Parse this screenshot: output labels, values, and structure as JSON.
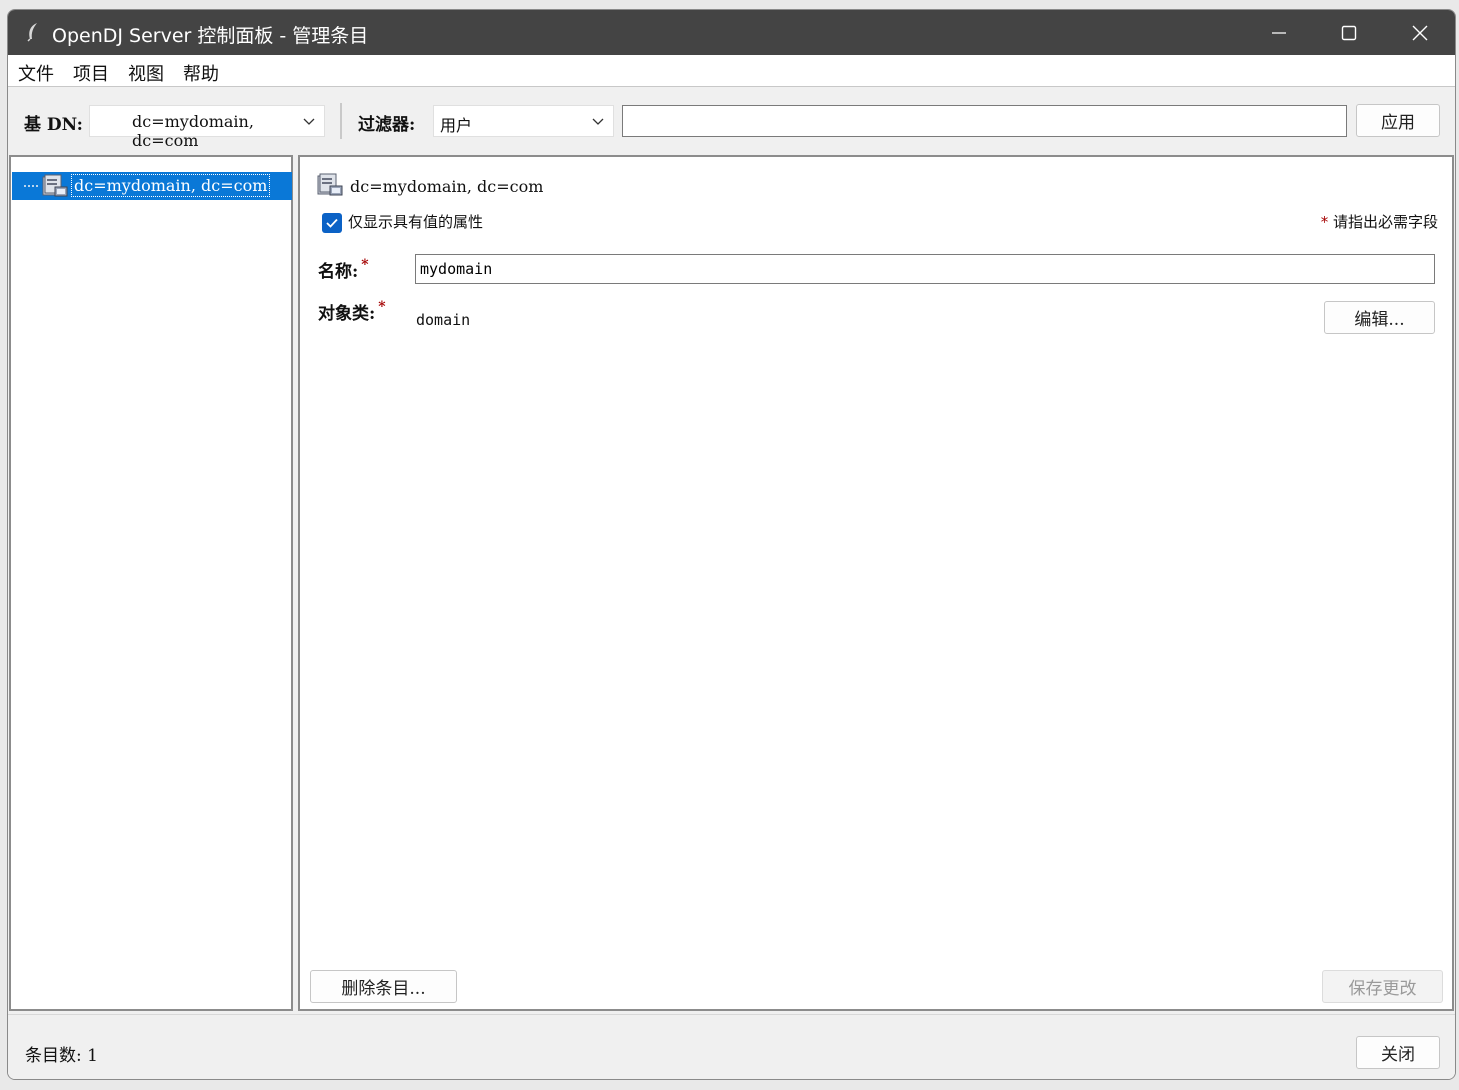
{
  "window": {
    "title": "OpenDJ Server 控制面板 - 管理条目",
    "minimize_icon": "minimize-icon",
    "maximize_icon": "maximize-icon",
    "close_icon": "close-icon"
  },
  "menu": {
    "file": "文件",
    "entry": "项目",
    "view": "视图",
    "help": "帮助"
  },
  "toolbar": {
    "base_dn_label": "基 DN:",
    "base_dn_value": "dc=mydomain, dc=com",
    "filter_label": "过滤器:",
    "filter_type": "用户",
    "filter_value": "",
    "apply_label": "应用"
  },
  "tree": {
    "selected_node": "dc=mydomain, dc=com"
  },
  "entry": {
    "dn": "dc=mydomain, dc=com",
    "only_show_attrs_label": "仅显示具有值的属性",
    "only_show_attrs_checked": true,
    "required_marker": "*",
    "required_note": "请指出必需字段",
    "name_label": "名称:",
    "name_value": "mydomain",
    "objectclass_label": "对象类:",
    "objectclass_value": "domain",
    "edit_label": "编辑...",
    "delete_label": "删除条目...",
    "save_label": "保存更改"
  },
  "status": {
    "count_text": "条目数: 1",
    "close_label": "关闭"
  },
  "colors": {
    "titlebar": "#444444",
    "selection": "#0a78d7",
    "required": "#a40000",
    "checkbox": "#0b62c6"
  }
}
